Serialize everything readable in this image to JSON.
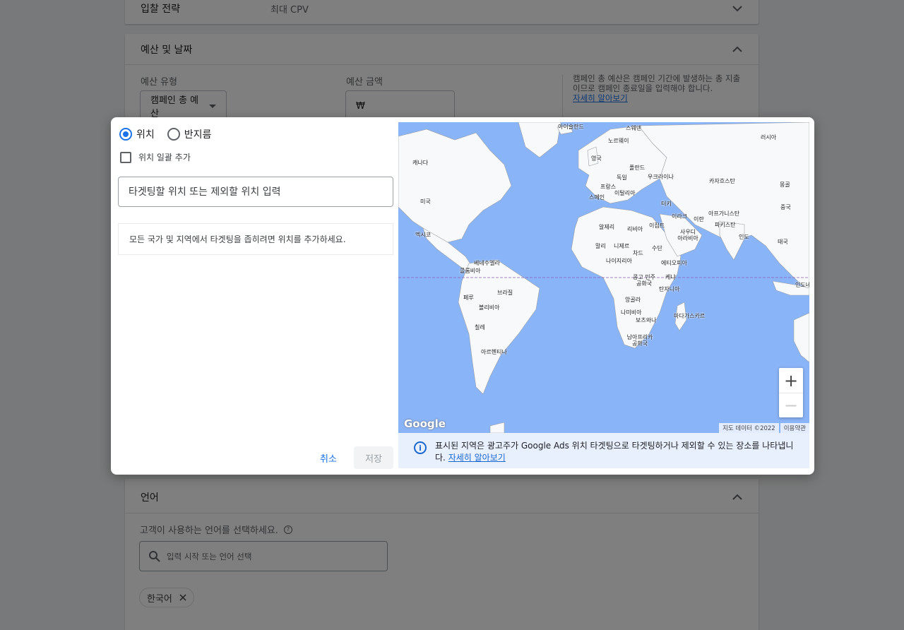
{
  "bidding": {
    "label": "입찰 전략",
    "value": "최대 CPV"
  },
  "budget": {
    "section_title": "예산 및 날짜",
    "type_label": "예산 유형",
    "type_value": "캠페인 총 예산",
    "amount_label": "예산 금액",
    "currency_symbol": "₩",
    "note_text": "캠페인 총 예산은 캠페인 기간에 발생하는 총 지출이므로 캠페인 종료일을 입력해야 합니다.",
    "note_link": "자세히 알아보기"
  },
  "dialog": {
    "radio_location": "위치",
    "radio_radius": "반지름",
    "bulk_add": "위치 일괄 추가",
    "input_placeholder": "타겟팅할 위치 또는 제외할 위치 입력",
    "hint": "모든 국가 및 지역에서 타겟팅을 좁히려면 위치를 추가하세요.",
    "cancel": "취소",
    "save": "저장",
    "info_text": "표시된 지역은 광고주가 Google Ads 위치 타겟팅으로 타겟팅하거나 제외할 수 있는 장소를 나타냅니다.",
    "info_link": "자세히 알아보기",
    "info_icon_glyph": "i"
  },
  "map": {
    "google_logo": "Google",
    "data_credit": "지도 데이터 ©2022",
    "terms": "이용약관",
    "zoom_in": "+",
    "zoom_out": "−",
    "labels": {
      "iceland": "아이슬란드",
      "sweden": "스웨덴",
      "norway": "노르웨이",
      "russia": "러시아",
      "canada": "캐나다",
      "uk": "영국",
      "poland": "폴란드",
      "germany": "독일",
      "ukraine": "우크라이나",
      "kazakhstan": "카자흐스탄",
      "france": "프랑스",
      "italy": "이탈리아",
      "mongolia": "몽골",
      "usa": "미국",
      "spain": "스페인",
      "turkey": "터키",
      "china": "중국",
      "iraq": "이라크",
      "iran": "이란",
      "afghanistan": "아프가니스탄",
      "algeria": "알제리",
      "libya": "리비아",
      "egypt": "이집트",
      "pakistan": "파키스탄",
      "mexico": "멕시코",
      "saudi": "사우디\n아라비아",
      "india": "인도",
      "thailand": "태국",
      "mali": "말리",
      "niger": "니제르",
      "sudan": "수단",
      "chad": "차드",
      "nigeria": "나이지리아",
      "ethiopia": "에티오피아",
      "venezuela": "베네수엘라",
      "colombia": "콜롬비아",
      "drc": "콩고 민주\n공화국",
      "kenya": "케냐",
      "indonesia": "인도네",
      "brazil": "브라질",
      "tanzania": "탄자니아",
      "peru": "페루",
      "bolivia": "볼리비아",
      "angola": "앙골라",
      "namibia": "나미비아",
      "madagascar": "마다가스카르",
      "botswana": "보츠와나",
      "chile": "칠레",
      "south_africa": "남아프리카\n공화국",
      "argentina": "아르헨티나"
    }
  },
  "language": {
    "section_title": "언어",
    "question": "고객이 사용하는 언어를 선택하세요.",
    "search_placeholder": "입력 시작 또는 언어 선택",
    "selected_chip": "한국어"
  },
  "colors": {
    "accent": "#1a73e8",
    "map_water": "#8ab4f8",
    "land": "#f8f9fa",
    "info_bg": "#e8f0fe"
  }
}
